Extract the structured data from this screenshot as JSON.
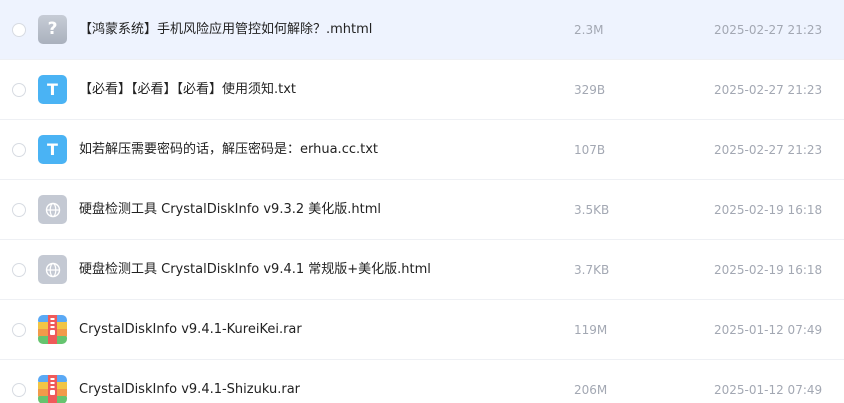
{
  "colors": {
    "selected_row_bg": "#eef3fe",
    "divider": "#eef0f4",
    "txt_icon": "#4ab3f4",
    "meta_text": "#a3a8b3"
  },
  "files": [
    {
      "icon": "unknown-file-icon",
      "glyph": "?",
      "name": "【鸿蒙系统】手机风险应用管控如何解除？.mhtml",
      "size": "2.3M",
      "date": "2025-02-27 21:23",
      "selected": true
    },
    {
      "icon": "txt-file-icon",
      "glyph": "T",
      "name": "【必看】【必看】【必看】使用须知.txt",
      "size": "329B",
      "date": "2025-02-27 21:23",
      "selected": false
    },
    {
      "icon": "txt-file-icon",
      "glyph": "T",
      "name": "如若解压需要密码的话，解压密码是：erhua.cc.txt",
      "size": "107B",
      "date": "2025-02-27 21:23",
      "selected": false
    },
    {
      "icon": "html-file-icon",
      "glyph": "",
      "name": "硬盘检测工具 CrystalDiskInfo v9.3.2 美化版.html",
      "size": "3.5KB",
      "date": "2025-02-19 16:18",
      "selected": false
    },
    {
      "icon": "html-file-icon",
      "glyph": "",
      "name": "硬盘检测工具 CrystalDiskInfo v9.4.1 常规版+美化版.html",
      "size": "3.7KB",
      "date": "2025-02-19 16:18",
      "selected": false
    },
    {
      "icon": "rar-file-icon",
      "glyph": "",
      "name": "CrystalDiskInfo v9.4.1-KureiKei.rar",
      "size": "119M",
      "date": "2025-01-12 07:49",
      "selected": false
    },
    {
      "icon": "rar-file-icon",
      "glyph": "",
      "name": "CrystalDiskInfo v9.4.1-Shizuku.rar",
      "size": "206M",
      "date": "2025-01-12 07:49",
      "selected": false
    }
  ]
}
